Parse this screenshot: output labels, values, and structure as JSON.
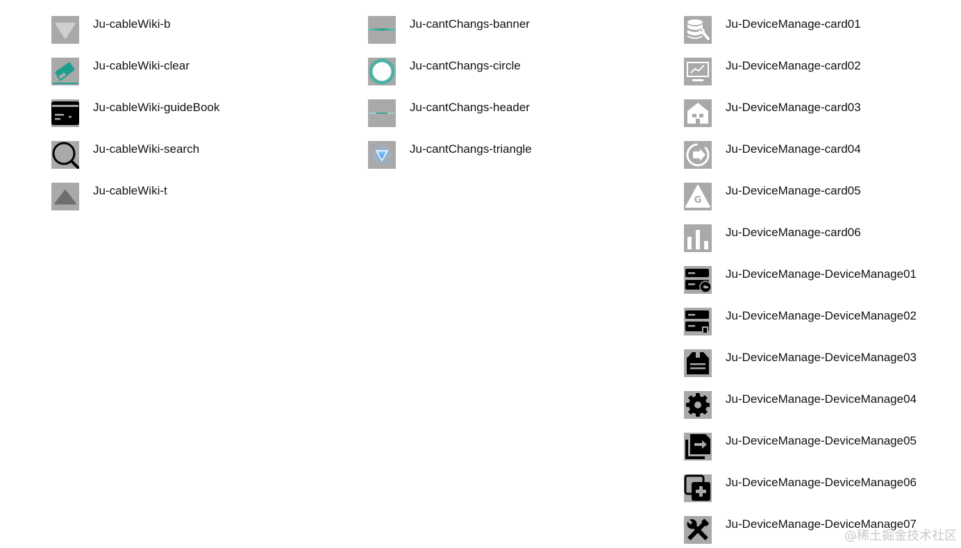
{
  "columns": [
    {
      "items": [
        {
          "label": "Ju-cableWiki-b",
          "icon": "triangle-down-icon"
        },
        {
          "label": "Ju-cableWiki-clear",
          "icon": "eraser-icon"
        },
        {
          "label": "Ju-cableWiki-guideBook",
          "icon": "card-icon"
        },
        {
          "label": "Ju-cableWiki-search",
          "icon": "magnifier-icon"
        },
        {
          "label": "Ju-cableWiki-t",
          "icon": "triangle-up-icon"
        }
      ]
    },
    {
      "items": [
        {
          "label": "Ju-cantChangs-banner",
          "icon": "banner-line-icon"
        },
        {
          "label": "Ju-cantChangs-circle",
          "icon": "ring-icon"
        },
        {
          "label": "Ju-cantChangs-header",
          "icon": "header-line-icon"
        },
        {
          "label": "Ju-cantChangs-triangle",
          "icon": "blue-triangle-icon"
        }
      ]
    },
    {
      "items": [
        {
          "label": "Ju-DeviceManage-card01",
          "icon": "database-wrench-icon"
        },
        {
          "label": "Ju-DeviceManage-card02",
          "icon": "monitor-chart-icon"
        },
        {
          "label": "Ju-DeviceManage-card03",
          "icon": "house-icon"
        },
        {
          "label": "Ju-DeviceManage-card04",
          "icon": "circular-arrow-icon"
        },
        {
          "label": "Ju-DeviceManage-card05",
          "icon": "g-triangle-icon"
        },
        {
          "label": "Ju-DeviceManage-card06",
          "icon": "bar-chart-icon"
        },
        {
          "label": "Ju-DeviceManage-DeviceManage01",
          "icon": "server-undo-icon"
        },
        {
          "label": "Ju-DeviceManage-DeviceManage02",
          "icon": "server-delete-icon"
        },
        {
          "label": "Ju-DeviceManage-DeviceManage03",
          "icon": "archive-box-icon"
        },
        {
          "label": "Ju-DeviceManage-DeviceManage04",
          "icon": "gear-icon"
        },
        {
          "label": "Ju-DeviceManage-DeviceManage05",
          "icon": "file-export-icon"
        },
        {
          "label": "Ju-DeviceManage-DeviceManage06",
          "icon": "copy-add-icon"
        },
        {
          "label": "Ju-DeviceManage-DeviceManage07",
          "icon": "wrench-screwdriver-icon"
        }
      ]
    }
  ],
  "watermark": "@稀土掘金技术社区",
  "colors": {
    "icon_tile": "#a9a9a9",
    "teal": "#1e9e8e",
    "blue": "#4aa8f0",
    "label": "#111111"
  }
}
